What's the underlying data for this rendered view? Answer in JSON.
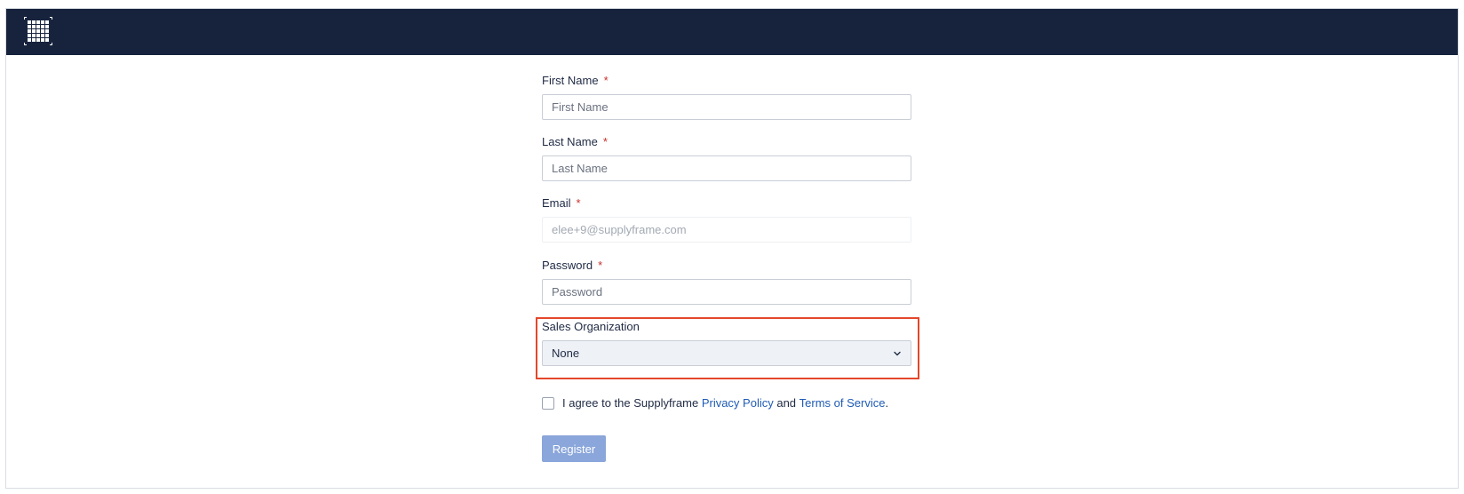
{
  "header": {
    "logo_icon": "grid-logo-icon",
    "background_color": "#17233d"
  },
  "form": {
    "first_name": {
      "label": "First Name",
      "required_mark": "*",
      "placeholder": "First Name",
      "value": ""
    },
    "last_name": {
      "label": "Last Name",
      "required_mark": "*",
      "placeholder": "Last Name",
      "value": ""
    },
    "email": {
      "label": "Email",
      "required_mark": "*",
      "value": "elee+9@supplyframe.com"
    },
    "password": {
      "label": "Password",
      "required_mark": "*",
      "placeholder": "Password",
      "value": ""
    },
    "sales_org": {
      "label": "Sales Organization",
      "selected": "None",
      "icon": "chevron-down-icon"
    },
    "agreement": {
      "text_before": "I agree to the Supplyframe ",
      "privacy_link": "Privacy Policy",
      "text_middle": " and ",
      "terms_link": "Terms of Service",
      "text_after": ".",
      "checked": false
    },
    "register_label": "Register"
  },
  "colors": {
    "required": "#c8302c",
    "link": "#1f5bb5",
    "highlight_box": "#e4472b",
    "register_button": "#8aa6da"
  }
}
